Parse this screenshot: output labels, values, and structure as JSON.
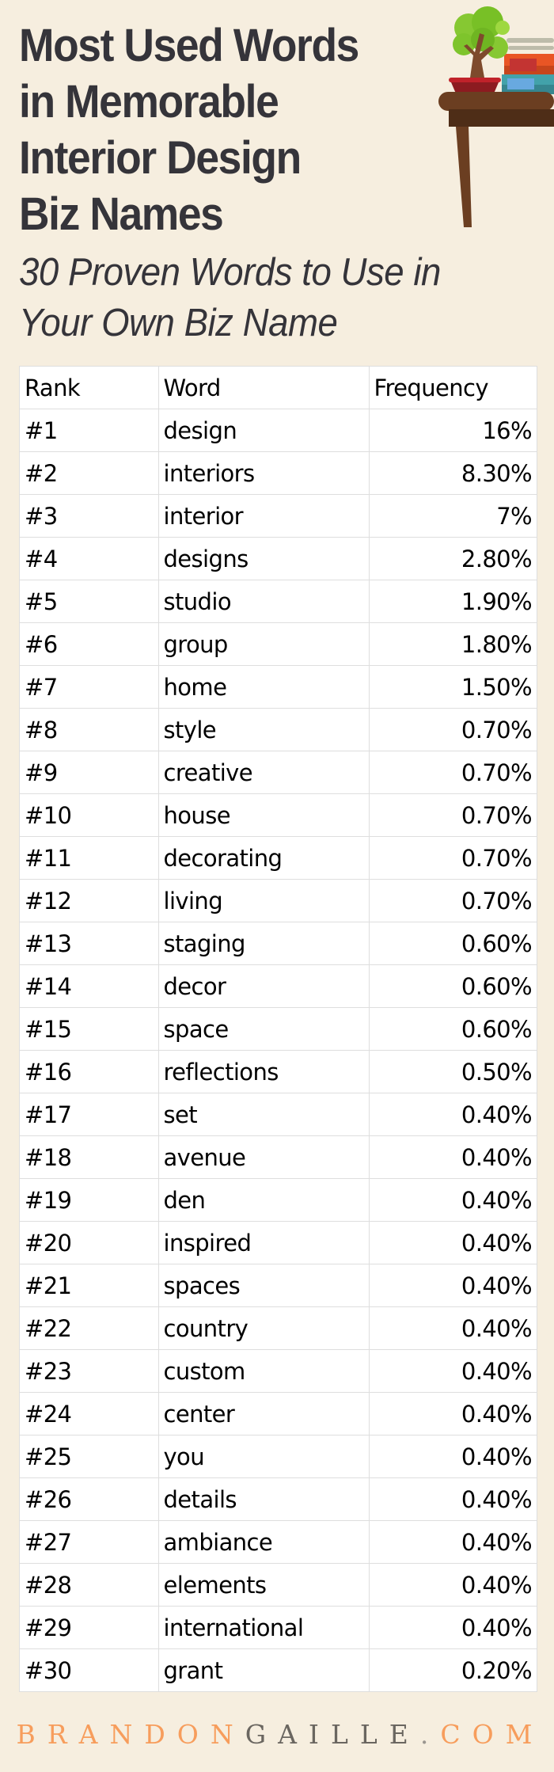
{
  "header": {
    "title_lines": [
      "Most Used Words",
      "in Memorable",
      "Interior Design",
      "Biz Names"
    ],
    "subtitle_lines": [
      "30 Proven Words to Use in",
      "Your Own Biz Name"
    ],
    "illustration": "bonsai-tree-on-table-with-books-icon"
  },
  "table": {
    "headers": [
      "Rank",
      "Word",
      "Frequency"
    ],
    "rows": [
      {
        "rank": "#1",
        "word": "design",
        "frequency": "16%"
      },
      {
        "rank": "#2",
        "word": "interiors",
        "frequency": "8.30%"
      },
      {
        "rank": "#3",
        "word": "interior",
        "frequency": "7%"
      },
      {
        "rank": "#4",
        "word": "designs",
        "frequency": "2.80%"
      },
      {
        "rank": "#5",
        "word": "studio",
        "frequency": "1.90%"
      },
      {
        "rank": "#6",
        "word": "group",
        "frequency": "1.80%"
      },
      {
        "rank": "#7",
        "word": "home",
        "frequency": "1.50%"
      },
      {
        "rank": "#8",
        "word": "style",
        "frequency": "0.70%"
      },
      {
        "rank": "#9",
        "word": "creative",
        "frequency": "0.70%"
      },
      {
        "rank": "#10",
        "word": "house",
        "frequency": "0.70%"
      },
      {
        "rank": "#11",
        "word": "decorating",
        "frequency": "0.70%"
      },
      {
        "rank": "#12",
        "word": "living",
        "frequency": "0.70%"
      },
      {
        "rank": "#13",
        "word": "staging",
        "frequency": "0.60%"
      },
      {
        "rank": "#14",
        "word": "decor",
        "frequency": "0.60%"
      },
      {
        "rank": "#15",
        "word": "space",
        "frequency": "0.60%"
      },
      {
        "rank": "#16",
        "word": "reflections",
        "frequency": "0.50%"
      },
      {
        "rank": "#17",
        "word": "set",
        "frequency": "0.40%"
      },
      {
        "rank": "#18",
        "word": "avenue",
        "frequency": "0.40%"
      },
      {
        "rank": "#19",
        "word": "den",
        "frequency": "0.40%"
      },
      {
        "rank": "#20",
        "word": "inspired",
        "frequency": "0.40%"
      },
      {
        "rank": "#21",
        "word": "spaces",
        "frequency": "0.40%"
      },
      {
        "rank": "#22",
        "word": "country",
        "frequency": "0.40%"
      },
      {
        "rank": "#23",
        "word": "custom",
        "frequency": "0.40%"
      },
      {
        "rank": "#24",
        "word": "center",
        "frequency": "0.40%"
      },
      {
        "rank": "#25",
        "word": "you",
        "frequency": "0.40%"
      },
      {
        "rank": "#26",
        "word": "details",
        "frequency": "0.40%"
      },
      {
        "rank": "#27",
        "word": "ambiance",
        "frequency": "0.40%"
      },
      {
        "rank": "#28",
        "word": "elements",
        "frequency": "0.40%"
      },
      {
        "rank": "#29",
        "word": "international",
        "frequency": "0.40%"
      },
      {
        "rank": "#30",
        "word": "grant",
        "frequency": "0.20%"
      }
    ]
  },
  "footer": {
    "brand_part1": "BRANDON",
    "brand_part2": "GAILLE",
    "dot": ".",
    "brand_part3": "COM"
  },
  "colors": {
    "background": "#f6eedf",
    "title": "#35343a",
    "brand_orange": "#f79d5c",
    "brand_gray": "#6a6660"
  }
}
